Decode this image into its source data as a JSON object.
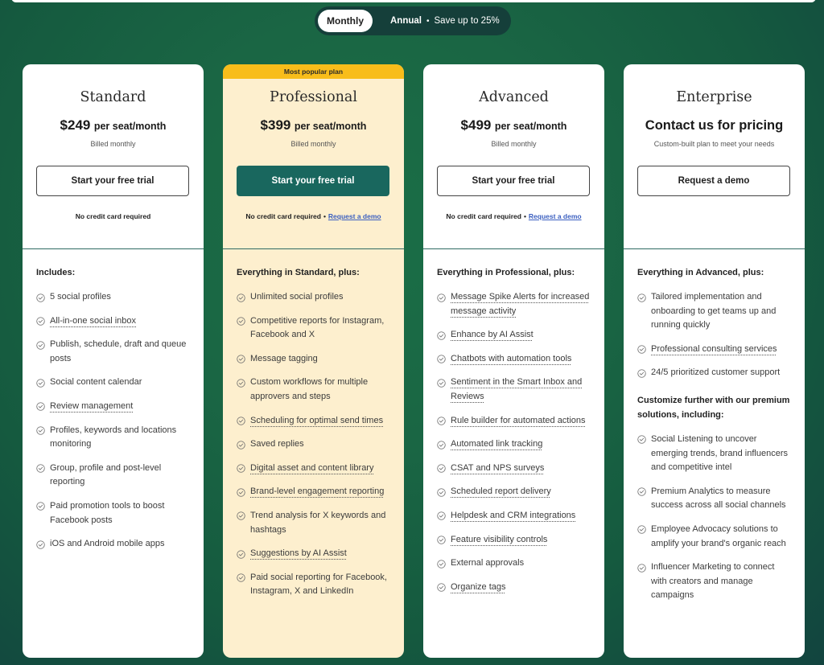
{
  "billing_toggle": {
    "monthly_label": "Monthly",
    "annual_label": "Annual",
    "separator": "•",
    "annual_savings": "Save up to 25%",
    "selected": "Monthly"
  },
  "colors": {
    "background": "#1a6644",
    "toggle_bg": "#153f3a",
    "featured_bg": "#fdefce",
    "badge": "#f8bd1a",
    "primary_button": "#19675e",
    "link": "#3b5fc0"
  },
  "plans": [
    {
      "name": "Standard",
      "price": "$249",
      "price_unit": "per seat/month",
      "billing_note": "Billed monthly",
      "cta_label": "Start your free trial",
      "note": "No credit card required",
      "note_link": "",
      "section_title": "Includes:",
      "features": [
        {
          "text": "5 social profiles",
          "tooltip": false
        },
        {
          "text": "All-in-one social inbox",
          "tooltip": true
        },
        {
          "text": "Publish, schedule, draft and queue posts",
          "tooltip": false
        },
        {
          "text": "Social content calendar",
          "tooltip": false
        },
        {
          "text": "Review management",
          "tooltip": true
        },
        {
          "text": "Profiles, keywords and locations monitoring",
          "tooltip": false
        },
        {
          "text": "Group, profile and post-level reporting",
          "tooltip": false
        },
        {
          "text": "Paid promotion tools to boost Facebook posts",
          "tooltip": false
        },
        {
          "text": "iOS and Android mobile apps",
          "tooltip": false
        }
      ]
    },
    {
      "name": "Professional",
      "badge": "Most popular plan",
      "price": "$399",
      "price_unit": "per seat/month",
      "billing_note": "Billed monthly",
      "cta_label": "Start your free trial",
      "note": "No credit card required",
      "note_link": "Request a demo",
      "section_title": "Everything in Standard, plus:",
      "features": [
        {
          "text": "Unlimited social profiles",
          "tooltip": false
        },
        {
          "text": "Competitive reports for Instagram, Facebook and X",
          "tooltip": false
        },
        {
          "text": "Message tagging",
          "tooltip": false
        },
        {
          "text": "Custom workflows for multiple approvers and steps",
          "tooltip": false
        },
        {
          "text": "Scheduling for optimal send times",
          "tooltip": true
        },
        {
          "text": "Saved replies",
          "tooltip": false
        },
        {
          "text": "Digital asset and content library",
          "tooltip": true
        },
        {
          "text": "Brand-level engagement reporting",
          "tooltip": true
        },
        {
          "text": "Trend analysis for X keywords and hashtags",
          "tooltip": false
        },
        {
          "text": "Suggestions by AI Assist",
          "tooltip": true
        },
        {
          "text": "Paid social reporting for Facebook, Instagram, X and LinkedIn",
          "tooltip": false
        }
      ]
    },
    {
      "name": "Advanced",
      "price": "$499",
      "price_unit": "per seat/month",
      "billing_note": "Billed monthly",
      "cta_label": "Start your free trial",
      "note": "No credit card required",
      "note_link": "Request a demo",
      "section_title": "Everything in Professional, plus:",
      "features": [
        {
          "text": "Message Spike Alerts for increased message activity",
          "tooltip": true
        },
        {
          "text": "Enhance by AI Assist",
          "tooltip": true
        },
        {
          "text": "Chatbots with automation tools",
          "tooltip": true
        },
        {
          "text": "Sentiment in the Smart Inbox and Reviews",
          "tooltip": true
        },
        {
          "text": "Rule builder for automated actions",
          "tooltip": true
        },
        {
          "text": "Automated link tracking",
          "tooltip": true
        },
        {
          "text": "CSAT and NPS surveys",
          "tooltip": true
        },
        {
          "text": "Scheduled report delivery",
          "tooltip": true
        },
        {
          "text": "Helpdesk and CRM integrations",
          "tooltip": true
        },
        {
          "text": "Feature visibility controls",
          "tooltip": true
        },
        {
          "text": "External approvals",
          "tooltip": false
        },
        {
          "text": "Organize tags",
          "tooltip": true
        }
      ]
    },
    {
      "name": "Enterprise",
      "price_contact": "Contact us for pricing",
      "billing_note": "Custom-built plan to meet your needs",
      "cta_label": "Request a demo",
      "section_title": "Everything in Advanced, plus:",
      "features": [
        {
          "text": "Tailored implementation and onboarding to get teams up and running quickly",
          "tooltip": false
        },
        {
          "text": "Professional consulting services",
          "tooltip": true
        },
        {
          "text": "24/5 prioritized customer support",
          "tooltip": false
        }
      ],
      "section2_title": "Customize further with our premium solutions, including:",
      "features2": [
        {
          "text": "Social Listening to uncover emerging trends, brand influencers and competitive intel",
          "tooltip": false
        },
        {
          "text": "Premium Analytics to measure success across all social channels",
          "tooltip": false
        },
        {
          "text": "Employee Advocacy solutions to amplify your brand's organic reach",
          "tooltip": false
        },
        {
          "text": "Influencer Marketing to connect with creators and manage campaigns",
          "tooltip": false
        }
      ]
    }
  ]
}
